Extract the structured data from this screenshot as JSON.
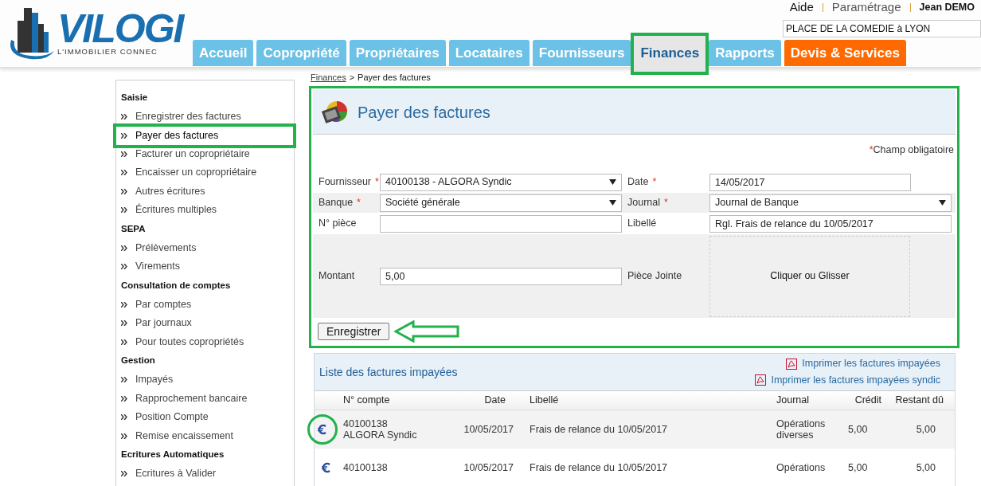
{
  "header": {
    "logo": {
      "name": "VILOGI",
      "tagline": "L'IMMOBILIER CONNEC"
    },
    "top_links": [
      {
        "label": "Aide",
        "kind": "main"
      },
      {
        "label": "Paramétrage",
        "kind": "main"
      },
      {
        "label": "Jean DEMO",
        "kind": "user"
      }
    ],
    "property_field": {
      "value": "PLACE DE LA COMEDIE à LYON"
    }
  },
  "nav_tabs": [
    {
      "label": "Accueil",
      "kind": "normal",
      "selected": false,
      "highlighted": false
    },
    {
      "label": "Copropriété",
      "kind": "normal",
      "selected": false,
      "highlighted": false
    },
    {
      "label": "Propriétaires",
      "kind": "normal",
      "selected": false,
      "highlighted": false
    },
    {
      "label": "Locataires",
      "kind": "normal",
      "selected": false,
      "highlighted": false
    },
    {
      "label": "Fournisseurs",
      "kind": "normal",
      "selected": false,
      "highlighted": false
    },
    {
      "label": "Finances",
      "kind": "normal",
      "selected": true,
      "highlighted": true
    },
    {
      "label": "Rapports",
      "kind": "normal",
      "selected": false,
      "highlighted": false
    },
    {
      "label": "Devis & Services",
      "kind": "promo",
      "selected": false,
      "highlighted": false
    }
  ],
  "sidebar": {
    "sections": [
      {
        "title": "Saisie",
        "items": [
          {
            "label": "Enregistrer des factures",
            "selected": false,
            "highlighted": false
          },
          {
            "label": "Payer des factures",
            "selected": true,
            "highlighted": true
          },
          {
            "label": "Facturer un copropriétaire",
            "selected": false,
            "highlighted": false
          },
          {
            "label": "Encaisser un copropriétaire",
            "selected": false,
            "highlighted": false
          },
          {
            "label": "Autres écritures",
            "selected": false,
            "highlighted": false
          },
          {
            "label": "Écritures multiples",
            "selected": false,
            "highlighted": false
          }
        ]
      },
      {
        "title": "SEPA",
        "items": [
          {
            "label": "Prélèvements",
            "selected": false,
            "highlighted": false
          },
          {
            "label": "Virements",
            "selected": false,
            "highlighted": false
          }
        ]
      },
      {
        "title": "Consultation de comptes",
        "items": [
          {
            "label": "Par comptes",
            "selected": false,
            "highlighted": false
          },
          {
            "label": "Par journaux",
            "selected": false,
            "highlighted": false
          },
          {
            "label": "Pour toutes copropriétés",
            "selected": false,
            "highlighted": false
          }
        ]
      },
      {
        "title": "Gestion",
        "items": [
          {
            "label": "Impayés",
            "selected": false,
            "highlighted": false
          },
          {
            "label": "Rapprochement bancaire",
            "selected": false,
            "highlighted": false
          },
          {
            "label": "Position Compte",
            "selected": false,
            "highlighted": false
          },
          {
            "label": "Remise encaissement",
            "selected": false,
            "highlighted": false
          }
        ]
      },
      {
        "title": "Ecritures Automatiques",
        "items": [
          {
            "label": "Ecritures à Valider",
            "selected": false,
            "highlighted": false
          }
        ]
      }
    ]
  },
  "breadcrumb": {
    "link": "Finances",
    "separator": ">",
    "current": "Payer des factures"
  },
  "form_panel": {
    "title": "Payer des factures",
    "highlighted": true,
    "required_note": {
      "mark": "*",
      "text": "Champ obligatoire"
    },
    "rows": [
      {
        "shaded": false,
        "fields": [
          {
            "label": "Fournisseur",
            "mark": "*",
            "kind": "select",
            "value": "40100138 - ALGORA Syndic"
          },
          {
            "label": "Date",
            "mark": "*",
            "kind": "date",
            "value": "14/05/2017"
          }
        ]
      },
      {
        "shaded": true,
        "fields": [
          {
            "label": "Banque",
            "mark": "*",
            "kind": "select",
            "value": "Société générale"
          },
          {
            "label": "Journal",
            "mark": "*",
            "kind": "select",
            "value": "Journal de Banque"
          }
        ]
      },
      {
        "shaded": false,
        "fields": [
          {
            "label": "N° pièce",
            "kind": "text"
          },
          {
            "label": "Libellé",
            "kind": "text",
            "value": "Rgl. Frais de relance du 10/05/2017"
          }
        ]
      },
      {
        "shaded": true,
        "fields": [
          {
            "label": "Montant",
            "kind": "text",
            "value": "5,00"
          },
          {
            "label": "Pièce Jointe",
            "kind": "dropzone",
            "value": "Cliquer ou Glisser"
          }
        ]
      }
    ],
    "submit": {
      "label": "Enregistrer",
      "pointed": true
    }
  },
  "invoices_panel": {
    "title": "Liste des factures impayées",
    "print_links": [
      "Imprimer les factures impayées",
      "Imprimer les factures impayées syndic"
    ],
    "columns": [
      "N° compte",
      "Date",
      "Libellé",
      "Journal",
      "Crédit",
      "Restant dû"
    ],
    "rows": [
      {
        "shaded": true,
        "highlighted": true,
        "account": [
          "40100138",
          "ALGORA Syndic"
        ],
        "date": "10/05/2017",
        "label": "Frais de relance du 10/05/2017",
        "journal": [
          "Opérations",
          "diverses"
        ],
        "credit": "5,00",
        "remaining": "5,00"
      },
      {
        "shaded": false,
        "highlighted": false,
        "account": [
          "40100138"
        ],
        "date": "10/05/2017",
        "label": "Frais de relance du 10/05/2017",
        "journal": [
          "Opérations"
        ],
        "credit": "5,00",
        "remaining": "5,00"
      }
    ]
  }
}
